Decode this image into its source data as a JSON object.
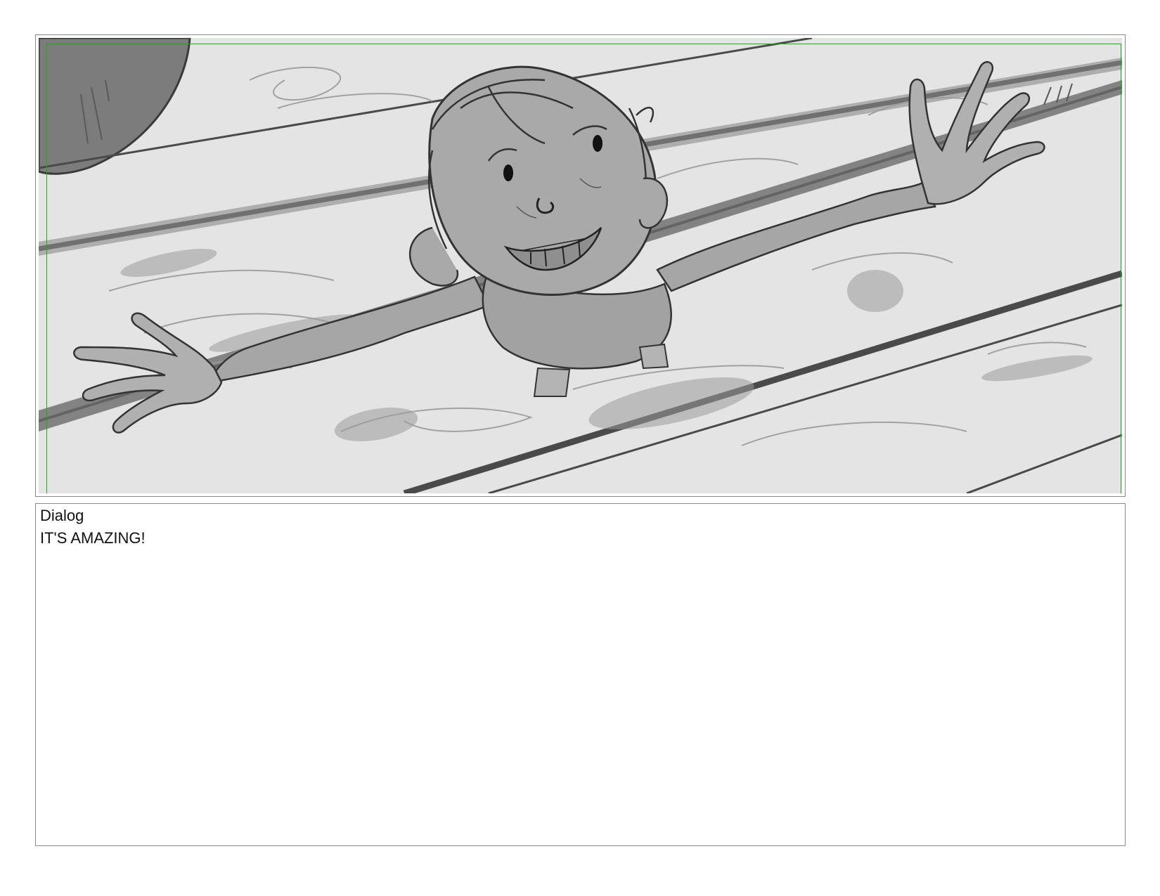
{
  "dialog": {
    "label": "Dialog",
    "text": "IT'S AMAZING!"
  },
  "panel": {
    "safe_area_color": "#3f8f3f",
    "frame_color": "#8a8a8a",
    "background_color": "#e6e6e6"
  }
}
